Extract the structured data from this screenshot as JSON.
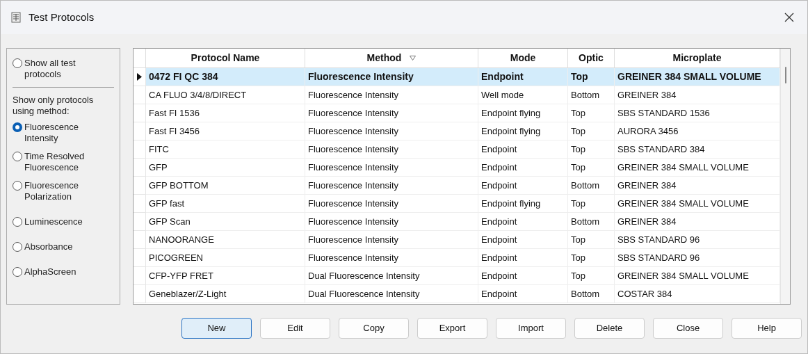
{
  "window": {
    "title": "Test Protocols"
  },
  "filter": {
    "show_all": {
      "label": "Show all test protocols",
      "selected": false
    },
    "caption": "Show only protocols using method:",
    "methods": [
      {
        "label": "Fluorescence Intensity",
        "selected": true
      },
      {
        "label": "Time Resolved Fluorescence",
        "selected": false
      },
      {
        "label": "Fluorescence Polarization",
        "selected": false
      },
      {
        "label": "Luminescence",
        "selected": false
      },
      {
        "label": "Absorbance",
        "selected": false
      },
      {
        "label": "AlphaScreen",
        "selected": false
      }
    ]
  },
  "table": {
    "columns": [
      {
        "label": "Protocol Name",
        "sorted": false
      },
      {
        "label": "Method",
        "sorted": true
      },
      {
        "label": "Mode",
        "sorted": false
      },
      {
        "label": "Optic",
        "sorted": false
      },
      {
        "label": "Microplate",
        "sorted": false
      }
    ],
    "rows": [
      {
        "selected": true,
        "cells": [
          "0472 FI QC 384",
          "Fluorescence Intensity",
          "Endpoint",
          "Top",
          "GREINER 384 SMALL VOLUME"
        ]
      },
      {
        "selected": false,
        "cells": [
          "CA FLUO 3/4/8/DIRECT",
          "Fluorescence Intensity",
          "Well mode",
          "Bottom",
          "GREINER 384"
        ]
      },
      {
        "selected": false,
        "cells": [
          "Fast FI 1536",
          "Fluorescence Intensity",
          "Endpoint flying",
          "Top",
          "SBS STANDARD 1536"
        ]
      },
      {
        "selected": false,
        "cells": [
          "Fast FI 3456",
          "Fluorescence Intensity",
          "Endpoint flying",
          "Top",
          "AURORA 3456"
        ]
      },
      {
        "selected": false,
        "cells": [
          "FITC",
          "Fluorescence Intensity",
          "Endpoint",
          "Top",
          "SBS STANDARD 384"
        ]
      },
      {
        "selected": false,
        "cells": [
          "GFP",
          "Fluorescence Intensity",
          "Endpoint",
          "Top",
          "GREINER 384 SMALL VOLUME"
        ]
      },
      {
        "selected": false,
        "cells": [
          "GFP BOTTOM",
          "Fluorescence Intensity",
          "Endpoint",
          "Bottom",
          "GREINER 384"
        ]
      },
      {
        "selected": false,
        "cells": [
          "GFP fast",
          "Fluorescence Intensity",
          "Endpoint flying",
          "Top",
          "GREINER 384 SMALL VOLUME"
        ]
      },
      {
        "selected": false,
        "cells": [
          "GFP Scan",
          "Fluorescence Intensity",
          "Endpoint",
          "Bottom",
          "GREINER 384"
        ]
      },
      {
        "selected": false,
        "cells": [
          "NANOORANGE",
          "Fluorescence Intensity",
          "Endpoint",
          "Top",
          "SBS STANDARD 96"
        ]
      },
      {
        "selected": false,
        "cells": [
          "PICOGREEN",
          "Fluorescence Intensity",
          "Endpoint",
          "Top",
          "SBS STANDARD 96"
        ]
      },
      {
        "selected": false,
        "cells": [
          "CFP-YFP FRET",
          "Dual Fluorescence Intensity",
          "Endpoint",
          "Top",
          "GREINER 384 SMALL VOLUME"
        ]
      },
      {
        "selected": false,
        "cells": [
          "Geneblazer/Z-Light",
          "Dual Fluorescence Intensity",
          "Endpoint",
          "Bottom",
          "COSTAR 384"
        ]
      }
    ]
  },
  "buttons": [
    {
      "label": "New",
      "default": true
    },
    {
      "label": "Edit",
      "default": false
    },
    {
      "label": "Copy",
      "default": false
    },
    {
      "label": "Export",
      "default": false
    },
    {
      "label": "Import",
      "default": false
    },
    {
      "label": "Delete",
      "default": false
    },
    {
      "label": "Close",
      "default": false
    },
    {
      "label": "Help",
      "default": false
    }
  ]
}
